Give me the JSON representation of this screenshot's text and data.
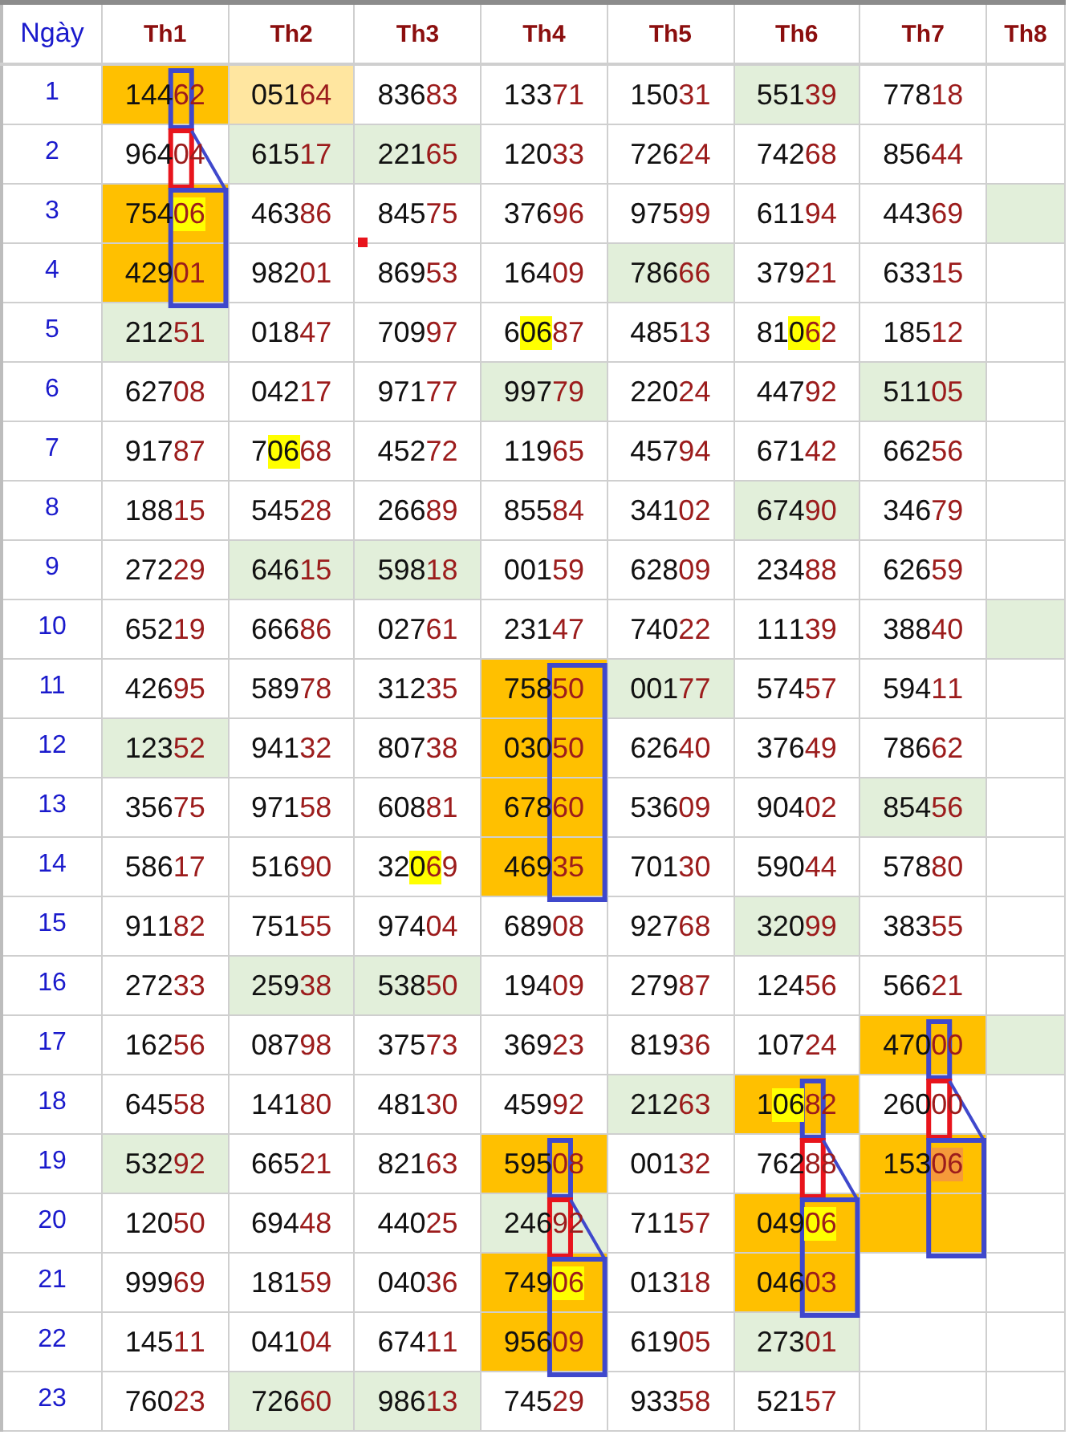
{
  "table": {
    "day_header": "Ngày",
    "columns": [
      {
        "label": "Th1"
      },
      {
        "label": "Th2"
      },
      {
        "label": "Th3"
      },
      {
        "label": "Th4"
      },
      {
        "label": "Th5"
      },
      {
        "label": "Th6"
      },
      {
        "label": "Th7"
      },
      {
        "label": "Th8"
      }
    ],
    "rows": [
      {
        "day": "1",
        "cells": [
          {
            "value": "14462",
            "color": "#ffc000",
            "frame": {
              "kind": "digit",
              "color": "#3f48cc"
            }
          },
          {
            "value": "05164",
            "color": "#ffe6a0"
          },
          {
            "value": "83683"
          },
          {
            "value": "13371"
          },
          {
            "value": "15031"
          },
          {
            "value": "55139",
            "color": "#e2efda"
          },
          {
            "value": "77818"
          },
          {}
        ]
      },
      {
        "day": "2",
        "cells": [
          {
            "value": "96404",
            "frame": {
              "kind": "digit",
              "color": "#e8141c"
            },
            "leader": true
          },
          {
            "value": "61517",
            "color": "#e2efda"
          },
          {
            "value": "22165",
            "color": "#e2efda"
          },
          {
            "value": "12033"
          },
          {
            "value": "72624"
          },
          {
            "value": "74268"
          },
          {
            "value": "85644"
          },
          {}
        ]
      },
      {
        "day": "3",
        "cells": [
          {
            "value": "75406",
            "color": "#ffc000",
            "highlight": {
              "kind": "tail",
              "color": "#ffff00"
            },
            "frame": {
              "kind": "pair",
              "color": "#3f48cc"
            }
          },
          {
            "value": "46386"
          },
          {
            "value": "84575"
          },
          {
            "value": "37696"
          },
          {
            "value": "97599"
          },
          {
            "value": "61194"
          },
          {
            "value": "44369"
          },
          {
            "color": "#e2efda"
          }
        ]
      },
      {
        "day": "4",
        "cells": [
          {
            "value": "42901",
            "color": "#ffc000",
            "frame": {
              "kind": "pair",
              "color": "#3f48cc"
            }
          },
          {
            "value": "98201"
          },
          {
            "value": "86953",
            "marker": true
          },
          {
            "value": "16409"
          },
          {
            "value": "78666",
            "color": "#e2efda"
          },
          {
            "value": "37921"
          },
          {
            "value": "63315"
          },
          {}
        ]
      },
      {
        "day": "5",
        "cells": [
          {
            "value": "21251",
            "color": "#e2efda"
          },
          {
            "value": "01847"
          },
          {
            "value": "70997"
          },
          {
            "value": "60687",
            "highlight": {
              "kind": "second",
              "color": "#ffff00"
            }
          },
          {
            "value": "48513"
          },
          {
            "value": "81062",
            "highlight": {
              "kind": "third",
              "color": "#ffff00"
            }
          },
          {
            "value": "18512"
          },
          {}
        ]
      },
      {
        "day": "6",
        "cells": [
          {
            "value": "62708"
          },
          {
            "value": "04217"
          },
          {
            "value": "97177"
          },
          {
            "value": "99779",
            "color": "#e2efda"
          },
          {
            "value": "22024"
          },
          {
            "value": "44792"
          },
          {
            "value": "51105",
            "color": "#e2efda"
          },
          {}
        ]
      },
      {
        "day": "7",
        "cells": [
          {
            "value": "91787"
          },
          {
            "value": "70668",
            "highlight": {
              "kind": "second",
              "color": "#ffff00"
            }
          },
          {
            "value": "45272"
          },
          {
            "value": "11965"
          },
          {
            "value": "45794"
          },
          {
            "value": "67142"
          },
          {
            "value": "66256"
          },
          {}
        ]
      },
      {
        "day": "8",
        "cells": [
          {
            "value": "18815"
          },
          {
            "value": "54528"
          },
          {
            "value": "26689"
          },
          {
            "value": "85584"
          },
          {
            "value": "34102"
          },
          {
            "value": "67490",
            "color": "#e2efda"
          },
          {
            "value": "34679"
          },
          {}
        ]
      },
      {
        "day": "9",
        "cells": [
          {
            "value": "27229"
          },
          {
            "value": "64615",
            "color": "#e2efda"
          },
          {
            "value": "59818",
            "color": "#e2efda"
          },
          {
            "value": "00159"
          },
          {
            "value": "62809"
          },
          {
            "value": "23488"
          },
          {
            "value": "62659"
          },
          {}
        ]
      },
      {
        "day": "10",
        "cells": [
          {
            "value": "65219"
          },
          {
            "value": "66686"
          },
          {
            "value": "02761"
          },
          {
            "value": "23147"
          },
          {
            "value": "74022"
          },
          {
            "value": "11139"
          },
          {
            "value": "38840"
          },
          {
            "color": "#e2efda"
          }
        ]
      },
      {
        "day": "11",
        "cells": [
          {
            "value": "42695"
          },
          {
            "value": "58978"
          },
          {
            "value": "31235"
          },
          {
            "value": "75850",
            "color": "#ffc000",
            "frame": {
              "kind": "pair",
              "color": "#3f48cc"
            }
          },
          {
            "value": "00177",
            "color": "#e2efda"
          },
          {
            "value": "57457"
          },
          {
            "value": "59411"
          },
          {}
        ]
      },
      {
        "day": "12",
        "cells": [
          {
            "value": "12352",
            "color": "#e2efda"
          },
          {
            "value": "94132"
          },
          {
            "value": "80738"
          },
          {
            "value": "03050",
            "color": "#ffc000",
            "frame": {
              "kind": "pair",
              "color": "#3f48cc"
            }
          },
          {
            "value": "62640"
          },
          {
            "value": "37649"
          },
          {
            "value": "78662"
          },
          {}
        ]
      },
      {
        "day": "13",
        "cells": [
          {
            "value": "35675"
          },
          {
            "value": "97158"
          },
          {
            "value": "60881"
          },
          {
            "value": "67860",
            "color": "#ffc000",
            "frame": {
              "kind": "pair",
              "color": "#3f48cc"
            }
          },
          {
            "value": "53609"
          },
          {
            "value": "90402"
          },
          {
            "value": "85456",
            "color": "#e2efda"
          },
          {}
        ]
      },
      {
        "day": "14",
        "cells": [
          {
            "value": "58617"
          },
          {
            "value": "51690"
          },
          {
            "value": "32069",
            "highlight": {
              "kind": "third",
              "color": "#ffff00"
            }
          },
          {
            "value": "46935",
            "color": "#ffc000",
            "frame": {
              "kind": "pair",
              "color": "#3f48cc"
            }
          },
          {
            "value": "70130"
          },
          {
            "value": "59044"
          },
          {
            "value": "57880"
          },
          {}
        ]
      },
      {
        "day": "15",
        "cells": [
          {
            "value": "91182"
          },
          {
            "value": "75155"
          },
          {
            "value": "97404"
          },
          {
            "value": "68908"
          },
          {
            "value": "92768"
          },
          {
            "value": "32099",
            "color": "#e2efda"
          },
          {
            "value": "38355"
          },
          {}
        ]
      },
      {
        "day": "16",
        "cells": [
          {
            "value": "27233"
          },
          {
            "value": "25938",
            "color": "#e2efda"
          },
          {
            "value": "53850",
            "color": "#e2efda"
          },
          {
            "value": "19409"
          },
          {
            "value": "27987"
          },
          {
            "value": "12456"
          },
          {
            "value": "56621"
          },
          {}
        ]
      },
      {
        "day": "17",
        "cells": [
          {
            "value": "16256"
          },
          {
            "value": "08798"
          },
          {
            "value": "37573"
          },
          {
            "value": "36923"
          },
          {
            "value": "81936"
          },
          {
            "value": "10724"
          },
          {
            "value": "47000",
            "color": "#ffc000",
            "frame": {
              "kind": "digit",
              "color": "#3f48cc"
            }
          },
          {
            "color": "#e2efda"
          }
        ]
      },
      {
        "day": "18",
        "cells": [
          {
            "value": "64558"
          },
          {
            "value": "14180"
          },
          {
            "value": "48130"
          },
          {
            "value": "45992"
          },
          {
            "value": "21263",
            "color": "#e2efda"
          },
          {
            "value": "10682",
            "color": "#ffc000",
            "highlight": {
              "kind": "second",
              "color": "#ffff00"
            },
            "frame": {
              "kind": "digit",
              "color": "#3f48cc"
            }
          },
          {
            "value": "26000",
            "frame": {
              "kind": "digit",
              "color": "#e8141c"
            },
            "leader": true
          },
          {}
        ]
      },
      {
        "day": "19",
        "cells": [
          {
            "value": "53292",
            "color": "#e2efda"
          },
          {
            "value": "66521"
          },
          {
            "value": "82163"
          },
          {
            "value": "59508",
            "color": "#ffc000",
            "frame": {
              "kind": "digit",
              "color": "#3f48cc"
            }
          },
          {
            "value": "00132"
          },
          {
            "value": "76288",
            "frame": {
              "kind": "digit",
              "color": "#e8141c"
            },
            "leader": true
          },
          {
            "value": "15306",
            "color": "#ffc000",
            "highlight": {
              "kind": "tail",
              "color": "#f59a3a"
            },
            "frame": {
              "kind": "pair",
              "color": "#3f48cc"
            }
          },
          {}
        ]
      },
      {
        "day": "20",
        "cells": [
          {
            "value": "12050"
          },
          {
            "value": "69448"
          },
          {
            "value": "44025"
          },
          {
            "value": "24692",
            "color": "#e2efda",
            "frame": {
              "kind": "digit",
              "color": "#e8141c"
            },
            "leader": true
          },
          {
            "value": "71157"
          },
          {
            "value": "04906",
            "color": "#ffc000",
            "highlight": {
              "kind": "tail",
              "color": "#ffff00"
            },
            "frame": {
              "kind": "pair",
              "color": "#3f48cc"
            }
          },
          {
            "color": "#ffc000",
            "frame": {
              "kind": "pair",
              "color": "#3f48cc"
            }
          },
          {}
        ]
      },
      {
        "day": "21",
        "cells": [
          {
            "value": "99969"
          },
          {
            "value": "18159"
          },
          {
            "value": "04036"
          },
          {
            "value": "74906",
            "color": "#ffc000",
            "highlight": {
              "kind": "tail",
              "color": "#ffff00"
            },
            "frame": {
              "kind": "pair",
              "color": "#3f48cc"
            }
          },
          {
            "value": "01318"
          },
          {
            "value": "04603",
            "color": "#ffc000",
            "frame": {
              "kind": "pair",
              "color": "#3f48cc"
            }
          },
          {},
          {}
        ]
      },
      {
        "day": "22",
        "cells": [
          {
            "value": "14511"
          },
          {
            "value": "04104"
          },
          {
            "value": "67411"
          },
          {
            "value": "95609",
            "color": "#ffc000",
            "frame": {
              "kind": "pair",
              "color": "#3f48cc"
            }
          },
          {
            "value": "61905"
          },
          {
            "value": "27301",
            "color": "#e2efda"
          },
          {},
          {}
        ]
      },
      {
        "day": "23",
        "cells": [
          {
            "value": "76023"
          },
          {
            "value": "72660",
            "color": "#e2efda"
          },
          {
            "value": "98613",
            "color": "#e2efda"
          },
          {
            "value": "74529"
          },
          {
            "value": "93358"
          },
          {
            "value": "52157"
          },
          {},
          {}
        ]
      }
    ]
  }
}
